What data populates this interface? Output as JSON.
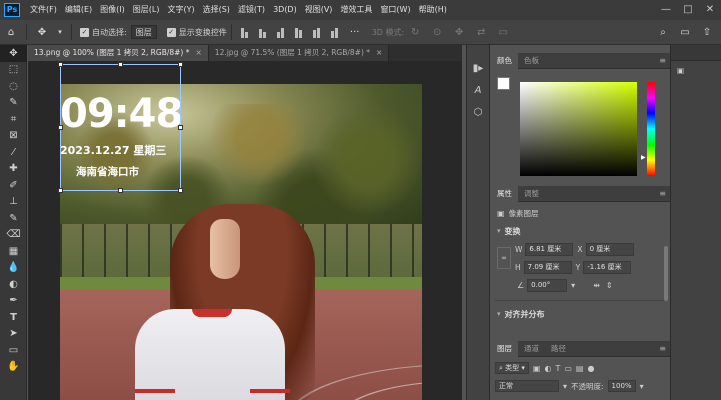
{
  "app": {
    "logo": "Ps"
  },
  "menubar": {
    "items": [
      "文件(F)",
      "编辑(E)",
      "图像(I)",
      "图层(L)",
      "文字(Y)",
      "选择(S)",
      "滤镜(T)",
      "3D(D)",
      "视图(V)",
      "增效工具",
      "窗口(W)",
      "帮助(H)"
    ],
    "window_controls": [
      "—",
      "□",
      "✕"
    ]
  },
  "optionsbar": {
    "auto_select_label": "自动选择:",
    "auto_select_value": "图层",
    "show_transform_label": "显示变换控件",
    "mode_3d_label": "3D 模式:"
  },
  "tabs": [
    {
      "label": "13.png @ 100% (图层 1 拷贝 2, RGB/8#) *",
      "close": "×",
      "active": true
    },
    {
      "label": "12.jpg @ 71.5% (图层 1 拷贝 2, RGB/8#) *",
      "close": "×",
      "active": false
    }
  ],
  "canvas_text": {
    "time": "09:48",
    "date": "2023.12.27  星期三",
    "location": "海南省海口市"
  },
  "toolbar": {
    "tools": [
      "move-tool",
      "marquee-tool",
      "lasso-tool",
      "quick-select-tool",
      "crop-tool",
      "frame-tool",
      "eyedropper-tool",
      "healing-tool",
      "brush-tool",
      "stamp-tool",
      "history-brush-tool",
      "eraser-tool",
      "gradient-tool",
      "blur-tool",
      "dodge-tool",
      "pen-tool",
      "type-tool",
      "path-select-tool",
      "shape-tool",
      "hand-tool"
    ]
  },
  "color_panel": {
    "tabs": [
      "颜色",
      "色板"
    ],
    "foreground": "#ffffff",
    "background": "#ffffff"
  },
  "properties_panel": {
    "tabs": [
      "属性",
      "调整"
    ],
    "layer_type": "像素图层",
    "transform_title": "变换",
    "w_label": "W",
    "w_value": "6.81 厘米",
    "h_label": "H",
    "h_value": "7.09 厘米",
    "x_label": "X",
    "x_value": "0 厘米",
    "y_label": "Y",
    "y_value": "-1.16 厘米",
    "angle_value": "0.00°",
    "align_title": "对齐并分布"
  },
  "layers_panel": {
    "tabs": [
      "图层",
      "通道",
      "路径"
    ],
    "filter_kind": "类型",
    "blend_mode": "正常",
    "opacity_label": "不透明度:",
    "opacity_value": "100%"
  }
}
